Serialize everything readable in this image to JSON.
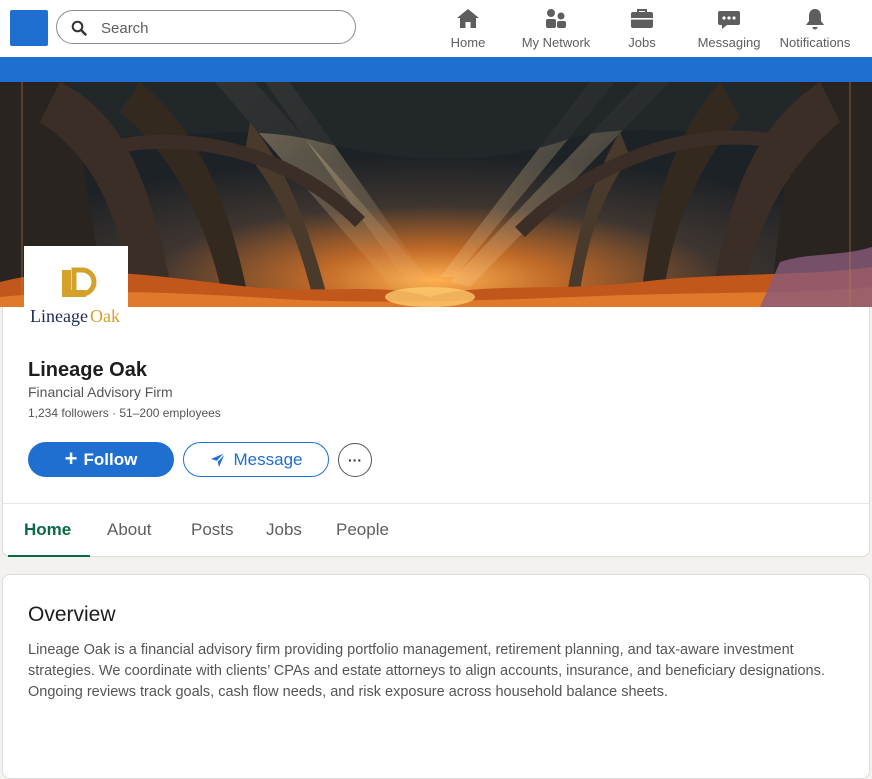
{
  "nav": {
    "search_placeholder": "Search",
    "items": [
      {
        "label": "Home",
        "icon": "home-icon"
      },
      {
        "label": "My Network",
        "icon": "network-icon"
      },
      {
        "label": "Jobs",
        "icon": "briefcase-icon"
      },
      {
        "label": "Messaging",
        "icon": "messaging-icon"
      },
      {
        "label": "Notifications",
        "icon": "bell-icon"
      }
    ]
  },
  "colors": {
    "brand_blue": "#1f6fd1",
    "active_tab": "#0b6a43",
    "logo_gold": "#d4a12a",
    "logo_navy": "#1e2a5a"
  },
  "company": {
    "logo_text_lineage": "Lineage",
    "logo_text_oak": "Oak",
    "name": "Lineage Oak",
    "type": "Financial Advisory Firm",
    "stats": "1,234 followers · 51–200 employees"
  },
  "actions": {
    "follow_label": "Follow",
    "message_label": "Message",
    "more_label": "···"
  },
  "tabs": [
    "Home",
    "About",
    "Posts",
    "Jobs",
    "People"
  ],
  "overview": {
    "title": "Overview",
    "text": "Lineage Oak is a financial advisory firm providing portfolio management, retirement planning, and tax-aware investment strategies. We coordinate with clients’ CPAs and estate attorneys to align accounts, insurance, and beneficiary designations. Ongoing reviews track goals, cash flow needs, and risk exposure across household balance sheets."
  }
}
